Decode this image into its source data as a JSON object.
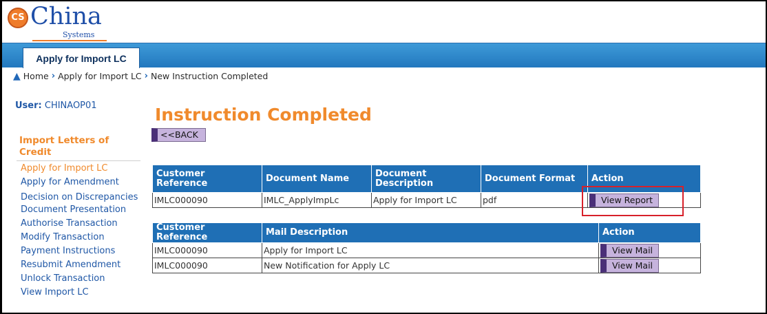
{
  "logo": {
    "badge": "CS",
    "word": "China",
    "sub": "Systems"
  },
  "tabs": [
    {
      "label": "Apply for Import LC"
    }
  ],
  "breadcrumb": {
    "home_icon": "home-icon",
    "home": "Home",
    "items": [
      "Apply for Import LC",
      "New Instruction Completed"
    ]
  },
  "user": {
    "label": "User:",
    "name": "CHINAOP01"
  },
  "sidebar": {
    "heading": "Import Letters of Credit",
    "items": [
      "Apply for Import LC",
      "Apply for Amendment",
      "Decision on Discrepancies",
      "Document Presentation",
      "Authorise Transaction",
      "Modify Transaction",
      "Payment Instructions",
      "Resubmit Amendment",
      "Unlock Transaction",
      "View Import LC"
    ],
    "active_index": 0
  },
  "main": {
    "title": "Instruction Completed",
    "back_label": "<<BACK",
    "documents": {
      "headers": [
        "Customer Reference",
        "Document Name",
        "Document Description",
        "Document Format",
        "Action"
      ],
      "rows": [
        {
          "ref": "IMLC000090",
          "name": "IMLC_ApplyImpLc",
          "description": "Apply for Import LC",
          "format": "pdf",
          "action": "View Report"
        }
      ]
    },
    "mails": {
      "headers": [
        "Customer Reference",
        "Mail Description",
        "Action"
      ],
      "rows": [
        {
          "ref": "IMLC000090",
          "description": "Apply for Import LC",
          "action": "View Mail"
        },
        {
          "ref": "IMLC000090",
          "description": "New Notification for Apply LC",
          "action": "View Mail"
        }
      ]
    }
  },
  "colors": {
    "accent_orange": "#f08a2c",
    "header_blue": "#1f6fb5",
    "button_purple": "#c6b3dd",
    "highlight_red": "#d7202a"
  }
}
